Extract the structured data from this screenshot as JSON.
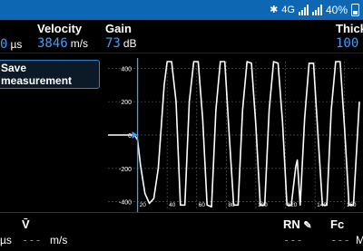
{
  "statusbar": {
    "bluetooth_icon": "bluetooth-icon",
    "network": "4G",
    "battery": "40%",
    "background": "#0e67b3"
  },
  "readings": {
    "time_unit": "µs",
    "time_value": "0",
    "velocity_label": "Velocity",
    "velocity_value": "3846",
    "velocity_unit": "m/s",
    "gain_label": "Gain",
    "gain_value": "73",
    "gain_unit": "dB",
    "thickness_label": "Thick",
    "thickness_value": "100"
  },
  "actions": {
    "save_label": "Save measurement"
  },
  "accent_color": "#3aa0ff",
  "chart_data": {
    "type": "line",
    "y_ticks": [
      "400",
      "200",
      "0",
      "-200",
      "-400"
    ],
    "x_ticks": [
      "20",
      "40",
      "60",
      "80",
      "100",
      "120",
      "140",
      "160"
    ],
    "xlim": [
      0,
      170
    ],
    "ylim": [
      -440,
      440
    ],
    "grid": true,
    "cursor_x": 20,
    "series": [
      {
        "color": "#ffffff",
        "x": [
          0,
          18,
          20,
          22,
          25,
          28,
          31,
          34,
          36,
          38,
          40,
          43,
          46,
          49,
          52,
          55,
          58,
          61,
          64,
          67,
          70,
          73,
          76,
          79,
          82,
          85,
          88,
          91,
          94,
          97,
          100,
          103,
          106,
          109,
          112,
          115,
          118,
          121,
          124,
          127,
          128,
          130,
          133,
          136,
          139,
          142,
          145,
          148,
          151,
          154,
          157,
          160,
          163,
          166,
          170
        ],
        "y": [
          0,
          0,
          -30,
          -180,
          -350,
          -410,
          -380,
          -200,
          50,
          300,
          440,
          440,
          200,
          -420,
          -420,
          200,
          440,
          440,
          100,
          -420,
          -430,
          150,
          440,
          440,
          0,
          -420,
          -420,
          150,
          440,
          430,
          60,
          -420,
          -420,
          150,
          440,
          430,
          80,
          -420,
          -420,
          -190,
          -150,
          -420,
          100,
          430,
          430,
          0,
          -420,
          -420,
          150,
          440,
          440,
          40,
          -420,
          -420,
          200
        ]
      }
    ]
  },
  "bottom": {
    "v_label": "V̄",
    "v_value": "---",
    "v_unit": "m/s",
    "left_unit": "µs",
    "rn_label": "RN",
    "rn_value": "---",
    "fc_label": "Fc",
    "fc_value": "---",
    "fc_unit": "M"
  }
}
